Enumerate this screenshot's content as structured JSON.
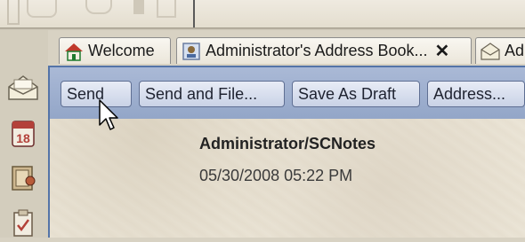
{
  "tabs": [
    {
      "label": "Welcome",
      "icon": "home-icon"
    },
    {
      "label": "Administrator's Address Book...",
      "icon": "address-book-icon",
      "close": "✕"
    },
    {
      "label": "Ad",
      "icon": "mail-icon"
    }
  ],
  "toolbar": {
    "send_label": "Send",
    "send_and_file_label": "Send and File...",
    "save_as_draft_label": "Save As Draft",
    "address_label": "Address..."
  },
  "message": {
    "from": "Administrator/SCNotes",
    "date": "05/30/2008 05:22 PM"
  },
  "left_icons": [
    "mail-icon",
    "calendar-icon",
    "contacts-icon",
    "todo-icon"
  ],
  "calendar_icon_text": "18",
  "colors": {
    "action_bar": "#9fb0d0",
    "button_border": "#5f6f93",
    "content_border": "#5474a8",
    "paper": "#ebe5d7"
  }
}
